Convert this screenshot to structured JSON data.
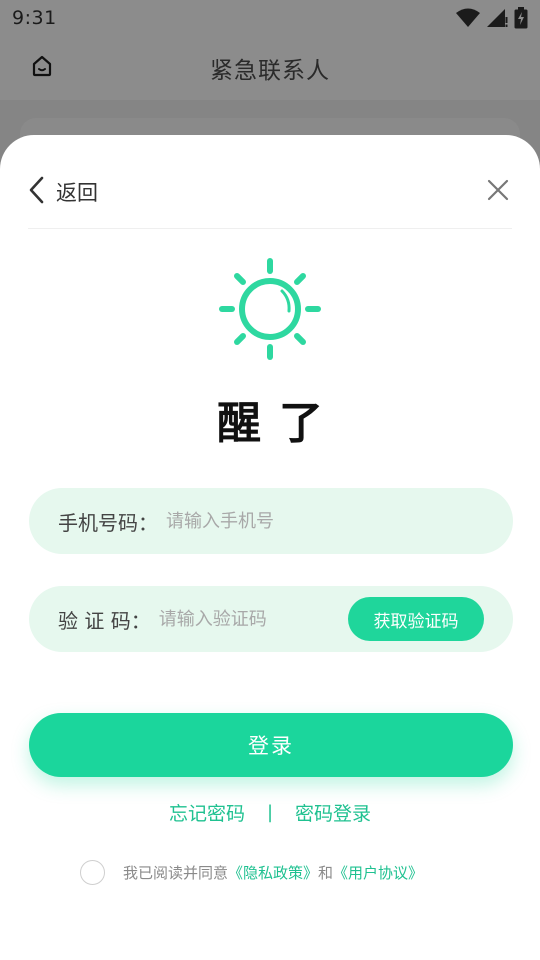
{
  "status_bar": {
    "time": "9:31"
  },
  "app_header": {
    "title": "紧急联系人"
  },
  "sheet": {
    "back_label": "返回",
    "brand_text": "醒了",
    "phone_field": {
      "label": "手机号码：",
      "placeholder": "请输入手机号"
    },
    "code_field": {
      "label": "验 证 码：",
      "placeholder": "请输入验证码",
      "get_code_label": "获取验证码"
    },
    "login_label": "登录",
    "forgot_password_label": "忘记密码",
    "separator": "|",
    "password_login_label": "密码登录",
    "agreement": {
      "prefix": "我已阅读并同意",
      "privacy_link": "《隐私政策》",
      "conjunction": "和",
      "terms_link": "《用户协议》"
    }
  },
  "colors": {
    "accent": "#1bd69c",
    "field_background": "#e6f8ee",
    "link": "#1fc190",
    "overlay": "#8c8c8c"
  },
  "icons": [
    "home-icon",
    "wifi-icon",
    "signal-icon",
    "battery-icon",
    "back-arrow-icon",
    "close-icon",
    "sun-logo-icon"
  ]
}
